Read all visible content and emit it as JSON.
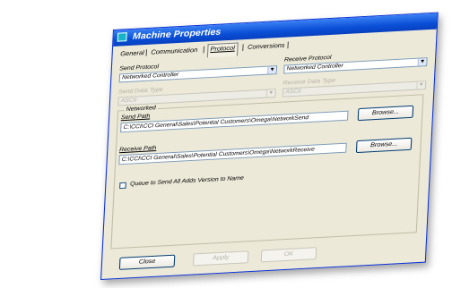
{
  "window": {
    "title": "Machine Properties",
    "accent": "#0a4fd6"
  },
  "tabs": [
    {
      "label": "General",
      "active": false
    },
    {
      "label": "Communication",
      "active": false
    },
    {
      "label": "Protocol",
      "active": true
    },
    {
      "label": "Conversions",
      "active": false
    }
  ],
  "send_protocol": {
    "label": "Send Protocol",
    "value": "Networked Controller"
  },
  "receive_protocol": {
    "label": "Receive Protocol",
    "value": "Networked Controller"
  },
  "send_data_type": {
    "label": "Send Data Type",
    "value": "ASCII",
    "enabled": false
  },
  "receive_data_type": {
    "label": "Receive Data Type",
    "value": "ASCII",
    "enabled": false
  },
  "networked": {
    "group_label": "Networked",
    "send_path": {
      "label": "Send Path",
      "value": "C:\\CCI\\CCI General\\Sales\\Potential Customers\\Omega\\NetworkSend",
      "browse_label": "Browse..."
    },
    "receive_path": {
      "label": "Receive Path",
      "value": "C:\\CCI\\CCI General\\Sales\\Potential Customers\\Omega\\NetworkReceive",
      "browse_label": "Browse..."
    },
    "queue_checkbox": {
      "label": "Queue to Send All Adds Version to Name",
      "checked": false
    }
  },
  "buttons": {
    "close": "Close",
    "apply": "Apply",
    "ok": "OK"
  }
}
